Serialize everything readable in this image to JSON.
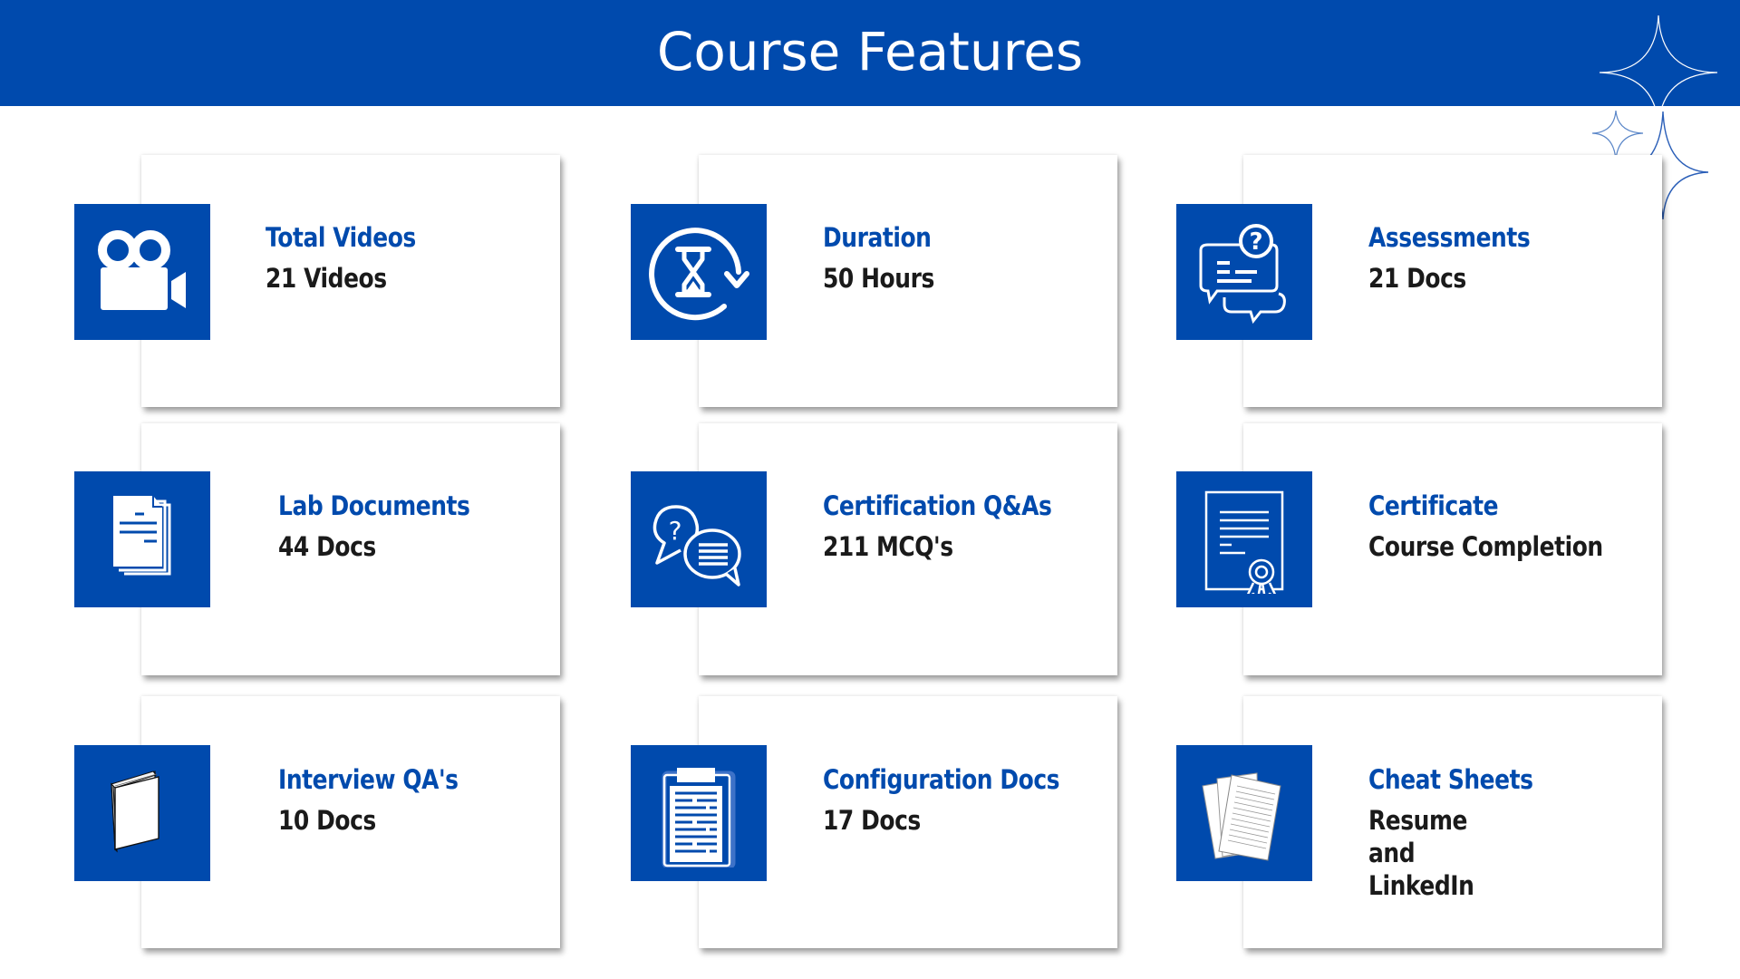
{
  "header": {
    "title": "Course Features"
  },
  "colors": {
    "brand": "#004AAD",
    "text_dark": "#1a1a1a",
    "card_bg": "#ffffff"
  },
  "features": [
    {
      "title": "Total Videos",
      "value": "21 Videos",
      "icon": "video-camera-icon"
    },
    {
      "title": "Duration",
      "value": "50 Hours",
      "icon": "hourglass-refresh-icon"
    },
    {
      "title": "Assessments",
      "value": "21 Docs",
      "icon": "question-chat-icon"
    },
    {
      "title": "Lab Documents",
      "value": "44 Docs",
      "icon": "documents-stack-icon"
    },
    {
      "title": "Certification Q&As",
      "value": "211 MCQ's",
      "icon": "speech-bubbles-question-icon"
    },
    {
      "title": "Certificate",
      "value": "Course Completion",
      "icon": "certificate-ribbon-icon"
    },
    {
      "title": "Interview QA's",
      "value": "10 Docs",
      "icon": "book-icon"
    },
    {
      "title": "Configuration Docs",
      "value": "17 Docs",
      "icon": "clipboard-icon"
    },
    {
      "title": "Cheat Sheets",
      "value": "Resume and LinkedIn",
      "icon": "paper-sheets-icon"
    }
  ]
}
